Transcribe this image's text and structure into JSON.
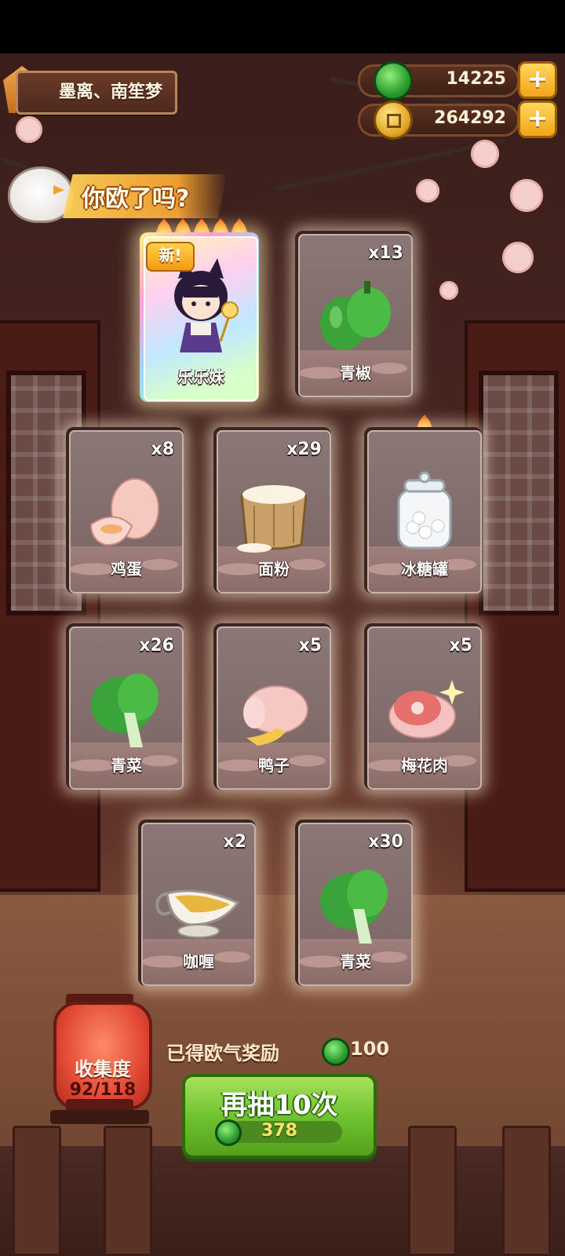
{
  "player": {
    "name": "墨离、南笙梦"
  },
  "currency": {
    "jade": "14225",
    "coins": "264292",
    "plus_label": "+"
  },
  "lucky_banner": "你欧了吗?",
  "featured_card": {
    "name": "乐乐妹",
    "new_tag": "新!",
    "flames": 5
  },
  "cards": [
    {
      "name": "青椒",
      "count": "x13"
    },
    {
      "name": "鸡蛋",
      "count": "x8"
    },
    {
      "name": "面粉",
      "count": "x29"
    },
    {
      "name": "冰糖罐",
      "count": ""
    },
    {
      "name": "青菜",
      "count": "x26"
    },
    {
      "name": "鸭子",
      "count": "x5"
    },
    {
      "name": "梅花肉",
      "count": "x5"
    },
    {
      "name": "咖喱",
      "count": "x2"
    },
    {
      "name": "青菜",
      "count": "x30"
    }
  ],
  "collection": {
    "title": "收集度",
    "progress": "92/118"
  },
  "reward": {
    "label": "已得欧气奖励",
    "value": "100"
  },
  "draw_button": {
    "label": "再抽10次",
    "cost": "378"
  },
  "colors": {
    "jade": "#2b9c2f",
    "coin": "#e4a92a",
    "button_green": "#6cc02c",
    "lantern_red": "#e24a36"
  }
}
